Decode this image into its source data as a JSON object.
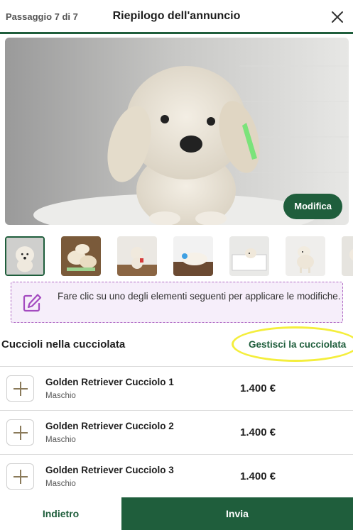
{
  "header": {
    "step": "Passaggio 7 di 7",
    "title": "Riepilogo dell'annuncio"
  },
  "hero": {
    "edit_label": "Modifica"
  },
  "thumbnails": [
    {
      "name": "thumb-1"
    },
    {
      "name": "thumb-2"
    },
    {
      "name": "thumb-3"
    },
    {
      "name": "thumb-4"
    },
    {
      "name": "thumb-5"
    },
    {
      "name": "thumb-6"
    },
    {
      "name": "thumb-7"
    }
  ],
  "hint": {
    "text": "Fare clic su uno degli elementi seguenti per applicare le modifiche."
  },
  "litter": {
    "title": "Cuccioli nella cucciolata",
    "manage_label": "Gestisci la cucciolata",
    "puppies": [
      {
        "name": "Golden Retriever Cucciolo 1",
        "sex": "Maschio",
        "price": "1.400 €"
      },
      {
        "name": "Golden Retriever Cucciolo 2",
        "sex": "Maschio",
        "price": "1.400 €"
      },
      {
        "name": "Golden Retriever Cucciolo 3",
        "sex": "Maschio",
        "price": "1.400 €"
      }
    ]
  },
  "footer": {
    "back_label": "Indietro",
    "send_label": "Invia"
  },
  "colors": {
    "brand_green": "#1f5e3c",
    "hint_border": "#b06ac4",
    "highlight": "#f4ee3c"
  }
}
